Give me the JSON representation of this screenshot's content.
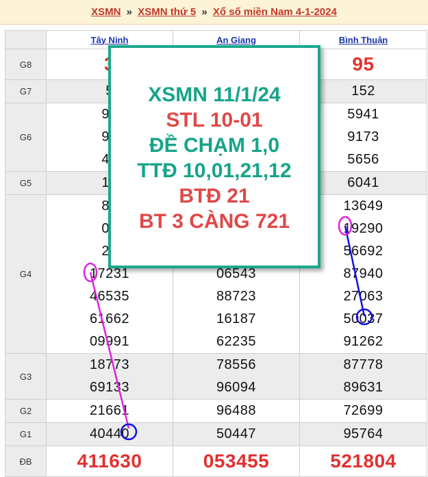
{
  "breadcrumb": {
    "items": [
      "XSMN",
      "XSMN thứ 5",
      "Xổ số miền Nam 4-1-2024"
    ],
    "separator": "»"
  },
  "provinces": [
    "Tây Ninh",
    "An Giang",
    "Bình Thuận"
  ],
  "prizes": [
    {
      "label": "G8",
      "style": "big",
      "values": [
        [
          "3"
        ],
        [
          ""
        ],
        [
          "95"
        ]
      ]
    },
    {
      "label": "G7",
      "style": "normal",
      "values": [
        [
          "5"
        ],
        [
          ""
        ],
        [
          "152"
        ]
      ]
    },
    {
      "label": "G6",
      "style": "normal",
      "values": [
        [
          "91",
          "92",
          "47"
        ],
        [
          "",
          "",
          ""
        ],
        [
          "5941",
          "9173",
          "5656"
        ]
      ]
    },
    {
      "label": "G5",
      "style": "normal",
      "values": [
        [
          "18"
        ],
        [
          ""
        ],
        [
          "6041"
        ]
      ]
    },
    {
      "label": "G4",
      "style": "normal",
      "values": [
        [
          "89",
          "02",
          "26",
          "17231",
          "46535",
          "61662",
          "09991"
        ],
        [
          "",
          "",
          "",
          "06543",
          "88723",
          "16187",
          "62235"
        ],
        [
          "13649",
          "19290",
          "56692",
          "87940",
          "27063",
          "50037",
          "91262"
        ]
      ]
    },
    {
      "label": "G3",
      "style": "normal",
      "values": [
        [
          "18773",
          "69133"
        ],
        [
          "78556",
          "96094"
        ],
        [
          "87778",
          "89631"
        ]
      ]
    },
    {
      "label": "G2",
      "style": "normal",
      "values": [
        [
          "21661"
        ],
        [
          "96488"
        ],
        [
          "72699"
        ]
      ]
    },
    {
      "label": "G1",
      "style": "normal",
      "values": [
        [
          "40440"
        ],
        [
          "50447"
        ],
        [
          "95764"
        ]
      ]
    },
    {
      "label": "ĐB",
      "style": "db",
      "values": [
        [
          "411630"
        ],
        [
          "053455"
        ],
        [
          "521804"
        ]
      ]
    }
  ],
  "overlay": {
    "lines": [
      {
        "text": "XSMN 11/1/24",
        "color": "teal"
      },
      {
        "text": "STL 10-01",
        "color": "red"
      },
      {
        "text": "ĐỀ CHẠM 1,0",
        "color": "teal"
      },
      {
        "text": "TTĐ 10,01,21,12",
        "color": "teal"
      },
      {
        "text": "BTĐ 21",
        "color": "red"
      },
      {
        "text": "BT 3 CÀNG 721",
        "color": "red"
      }
    ]
  },
  "colors": {
    "accent": "#e03131",
    "teal": "#17a489",
    "header_link": "#1a33a8",
    "magenta": "#e020e0",
    "blue": "#1010e0"
  }
}
